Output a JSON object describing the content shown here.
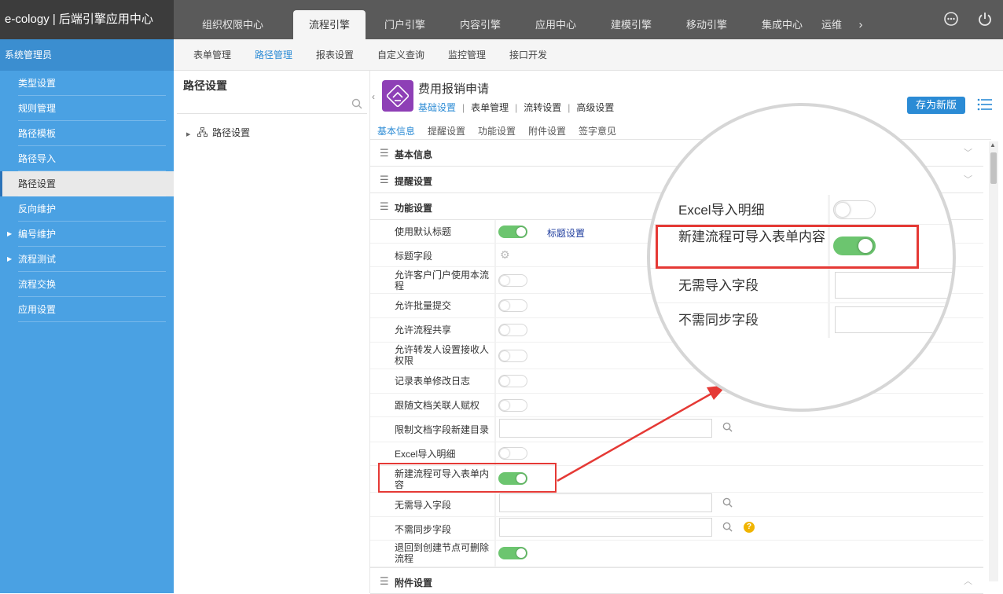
{
  "brand": "e-cology | 后端引擎应用中心",
  "topnav": {
    "tabs": [
      {
        "label": "组织权限中心"
      },
      {
        "label": "流程引擎"
      },
      {
        "label": "门户引擎"
      },
      {
        "label": "内容引擎"
      },
      {
        "label": "应用中心"
      },
      {
        "label": "建模引擎"
      },
      {
        "label": "移动引擎"
      },
      {
        "label": "集成中心"
      },
      {
        "label": "运维"
      }
    ],
    "active_index": 1,
    "more_icon": "chevron-right-icon",
    "icons": [
      "more-options-icon",
      "power-icon"
    ]
  },
  "subnav": {
    "items": [
      "表单管理",
      "路径管理",
      "报表设置",
      "自定义查询",
      "监控管理",
      "接口开发"
    ],
    "active_index": 1
  },
  "sidebar": {
    "admin_label": "系统管理员",
    "items": [
      {
        "label": "类型设置"
      },
      {
        "label": "规则管理"
      },
      {
        "label": "路径模板"
      },
      {
        "label": "路径导入"
      },
      {
        "label": "路径设置"
      },
      {
        "label": "反向维护"
      },
      {
        "label": "编号维护"
      },
      {
        "label": "流程测试"
      },
      {
        "label": "流程交换"
      },
      {
        "label": "应用设置"
      }
    ],
    "active_index": 4
  },
  "tree": {
    "title": "路径设置",
    "search_placeholder": "",
    "node_label": "路径设置"
  },
  "main": {
    "app_title": "费用报销申请",
    "primary_tabs": [
      "基础设置",
      "表单管理",
      "流转设置",
      "高级设置"
    ],
    "primary_active": 0,
    "save_button": "存为新版",
    "secondary_tabs": [
      "基本信息",
      "提醒设置",
      "功能设置",
      "附件设置",
      "签字意见"
    ],
    "secondary_active": 0,
    "sections": {
      "basic": "基本信息",
      "reminder": "提醒设置",
      "function": "功能设置",
      "attachment": "附件设置"
    },
    "settings": {
      "use_default_title": {
        "label": "使用默认标题",
        "on": true,
        "link": "标题设置"
      },
      "title_field": {
        "label": "标题字段"
      },
      "allow_customer_portal": {
        "label": "允许客户门户使用本流程",
        "on": false
      },
      "allow_batch_submit": {
        "label": "允许批量提交",
        "on": false
      },
      "allow_share": {
        "label": "允许流程共享",
        "on": false
      },
      "allow_forwarder": {
        "label": "允许转发人设置接收人权限",
        "on": false
      },
      "record_form_log": {
        "label": "记录表单修改日志",
        "on": false
      },
      "follow_doc": {
        "label": "跟随文档关联人赋权",
        "on": false
      },
      "limit_doc_dir": {
        "label": "限制文档字段新建目录",
        "value": ""
      },
      "excel_import": {
        "label": "Excel导入明细",
        "on": false
      },
      "new_import_form": {
        "label": "新建流程可导入表单内容",
        "on": true
      },
      "no_import_fields": {
        "label": "无需导入字段",
        "value": ""
      },
      "no_sync_fields": {
        "label": "不需同步字段",
        "value": ""
      },
      "return_delete": {
        "label": "退回到创建节点可删除流程",
        "on": true
      }
    }
  },
  "colors": {
    "accent": "#2b8bd5",
    "sidebar": "#4aa1e3",
    "topbar": "#5a5a5a",
    "toggle_on": "#6cc56f",
    "highlight": "#e53935"
  }
}
